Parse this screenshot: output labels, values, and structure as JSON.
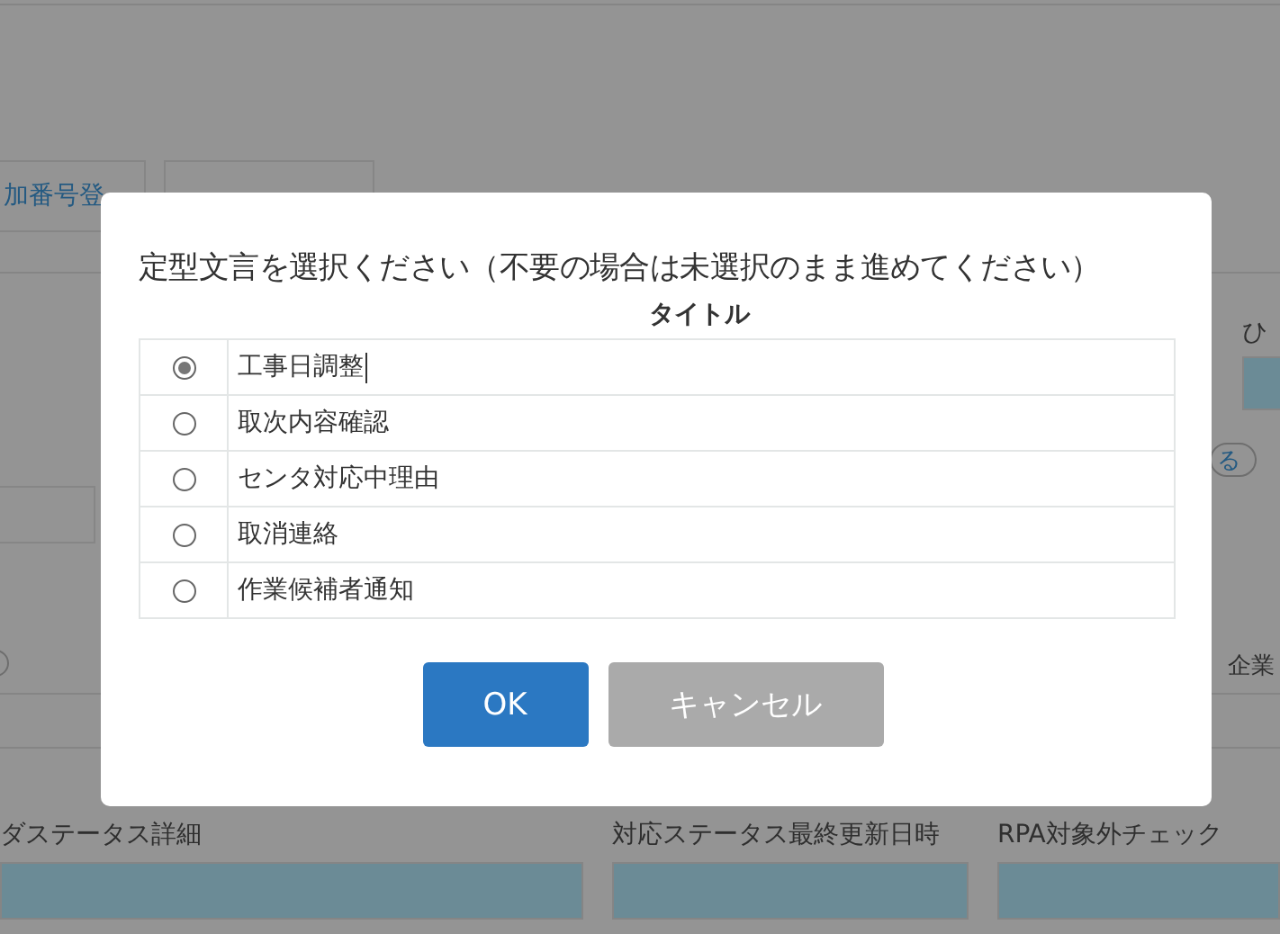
{
  "background": {
    "buttons": [
      {
        "label": "加番号登"
      }
    ],
    "side_label": "ひ",
    "pill_button": "る",
    "side_radio": {
      "checked": false
    },
    "side_text": "企業",
    "fields": [
      {
        "label": "ダステータス詳細"
      },
      {
        "label": "対応ステータス最終更新日時"
      },
      {
        "label": "RPA対象外チェック"
      }
    ]
  },
  "dialog": {
    "title": "定型文言を選択ください（不要の場合は未選択のまま進めてください）",
    "column": "タイトル",
    "options": [
      {
        "label": "工事日調整",
        "selected": true
      },
      {
        "label": "取次内容確認",
        "selected": false
      },
      {
        "label": "センタ対応中理由",
        "selected": false
      },
      {
        "label": "取消連絡",
        "selected": false
      },
      {
        "label": "作業候補者通知",
        "selected": false
      }
    ],
    "buttons": [
      {
        "label": "OK",
        "kind": "primary"
      },
      {
        "label": "キャンセル",
        "kind": "secondary"
      }
    ]
  }
}
